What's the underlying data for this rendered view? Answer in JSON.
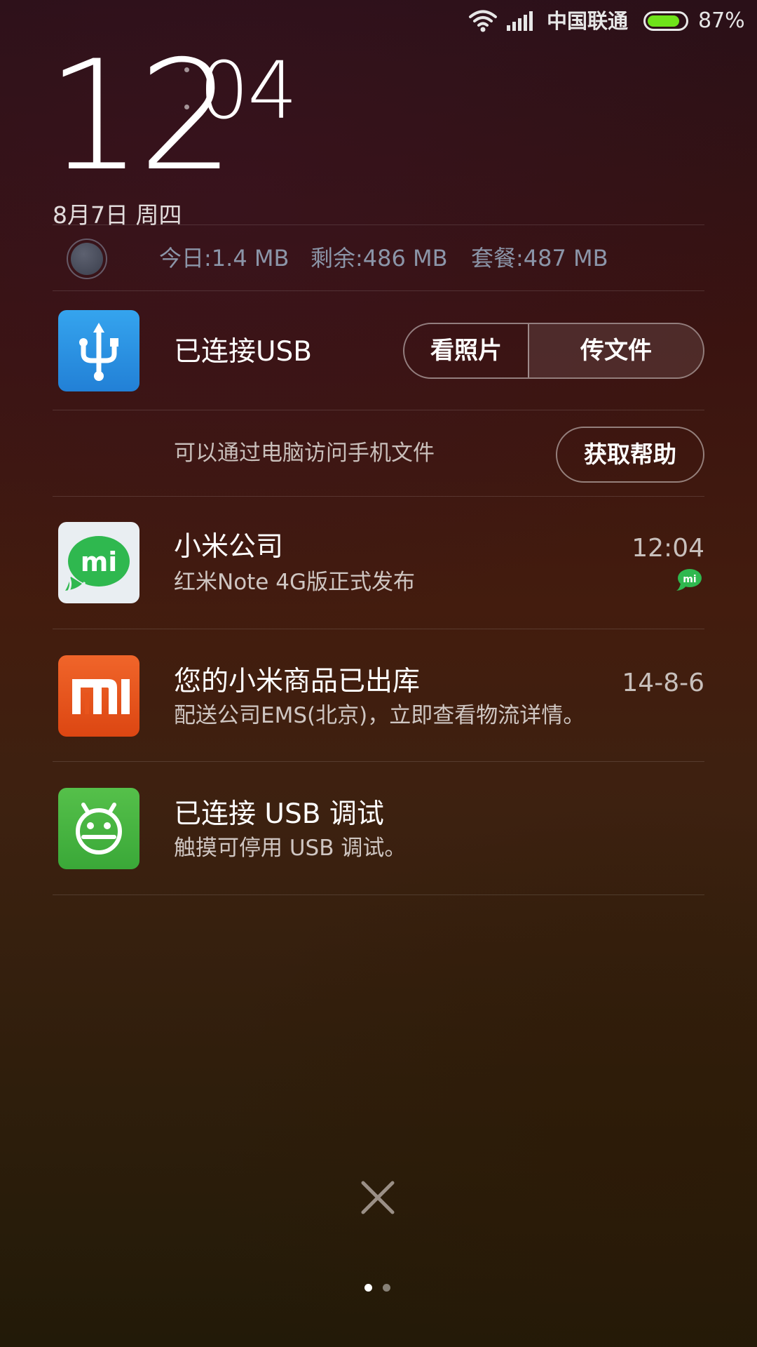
{
  "status_bar": {
    "carrier": "中国联通",
    "battery_percent": "87%",
    "battery_level": 0.87,
    "battery_color": "#6fe21a",
    "icons": [
      "wifi-icon",
      "signal-icon",
      "battery-icon"
    ]
  },
  "lockscreen": {
    "clock_hour": "12",
    "clock_minute": "04",
    "date": "8月7日 周四"
  },
  "data_usage": {
    "today": "今日:1.4 MB",
    "remaining": "剩余:486 MB",
    "plan": "套餐:487 MB"
  },
  "usb_notification": {
    "icon": "usb-icon",
    "title": "已连接USB",
    "view_photos_label": "看照片",
    "transfer_files_label": "传文件",
    "description": "可以通过电脑访问手机文件",
    "help_label": "获取帮助"
  },
  "notifications": [
    {
      "app": "mitalk",
      "icon": "mitalk-icon",
      "title": "小米公司",
      "subtitle": "红米Note 4G版正式发布",
      "time": "12:04"
    },
    {
      "app": "mi-store",
      "icon": "mi-logo-icon",
      "title": "您的小米商品已出库",
      "subtitle": "配送公司EMS(北京)，立即查看物流详情。",
      "time": "14-8-6"
    },
    {
      "app": "usb-debugging",
      "icon": "android-icon",
      "title": "已连接 USB 调试",
      "subtitle": "触摸可停用 USB 调试。",
      "time": ""
    }
  ],
  "bottom": {
    "close_icon": "close-icon",
    "page_count": 2,
    "current_page": 1
  },
  "colors": {
    "usb_blue": "#2a8ee0",
    "mitalk_green": "#34c759",
    "mi_orange": "#e8541c",
    "android_green": "#4cb848"
  }
}
